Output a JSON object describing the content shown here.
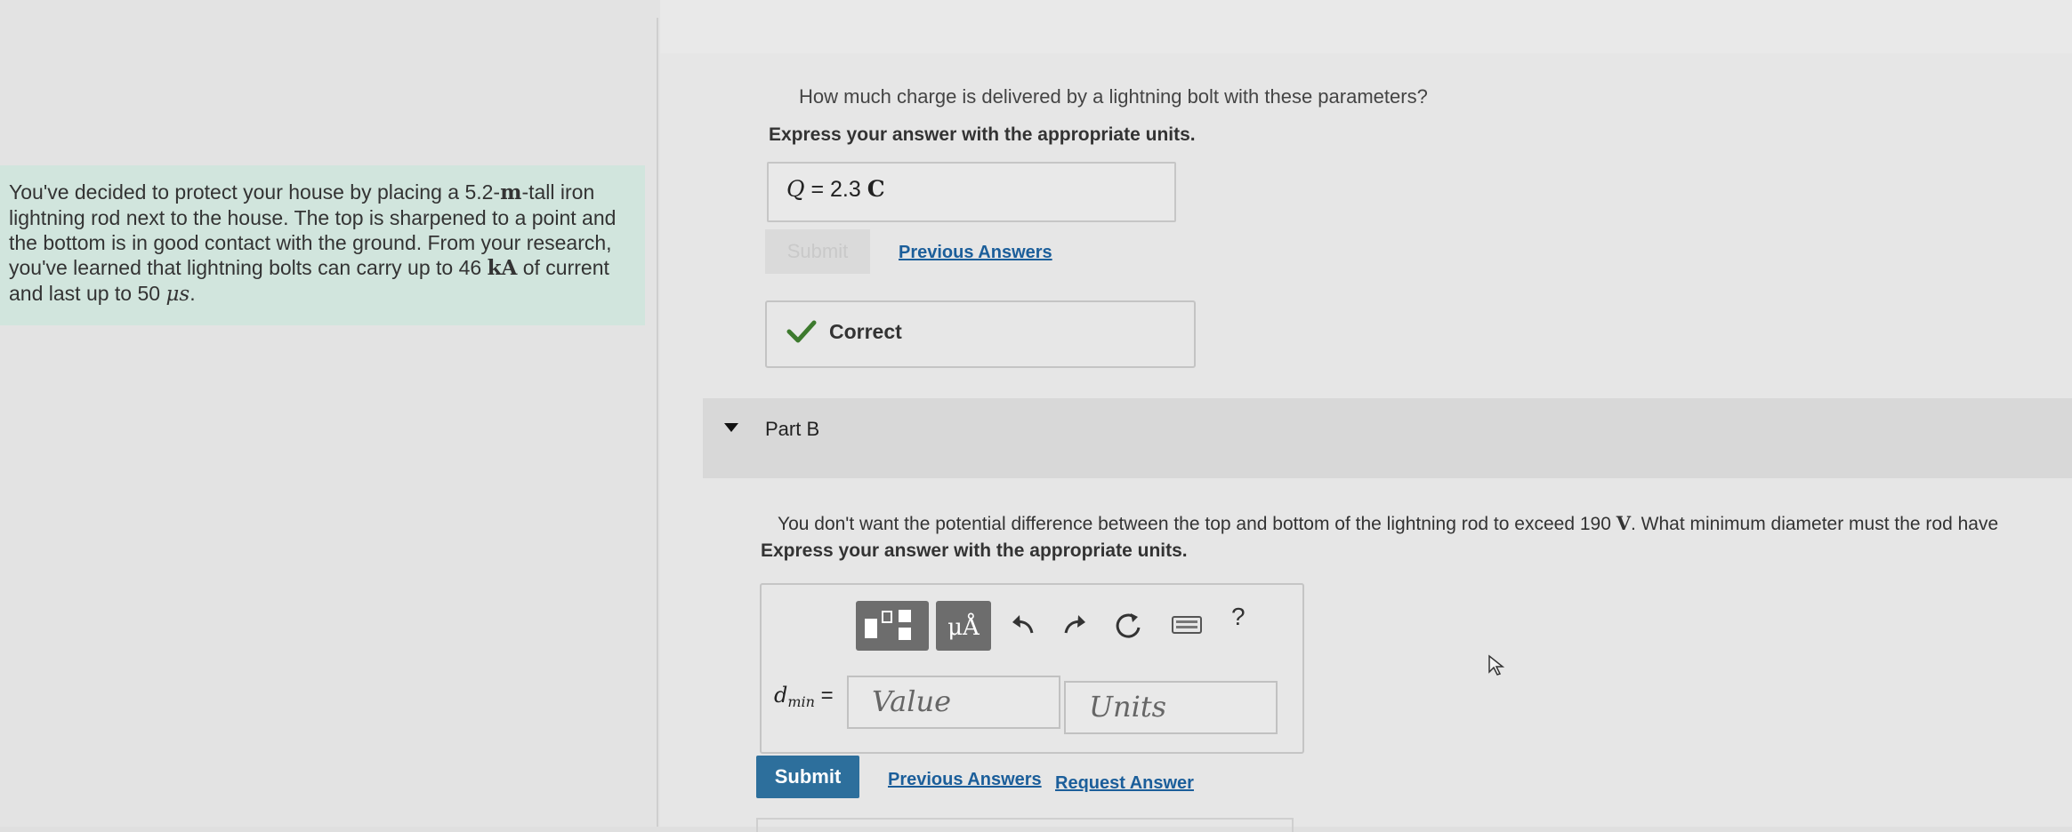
{
  "problem": {
    "t1": "You've decided to protect your house by placing a 5.2-",
    "u1": "m",
    "t2": "-tall iron lightning rod next to the house. The top is sharpened to a point and the bottom is in good contact with the ground. From your research, you've learned that lightning bolts can carry up to 46 ",
    "u2": "kA",
    "t3": " of current and last up to 50 ",
    "u3": "μs",
    "t4": "."
  },
  "part_a": {
    "question": "How much charge is delivered by a lightning bolt with these parameters?",
    "instruction": "Express your answer with the appropriate units.",
    "answer_var": "Q",
    "answer_eq": " = ",
    "answer_value": "2.3 ",
    "answer_unit": "C",
    "submit_label": "Submit",
    "previous_answers_label": "Previous Answers",
    "result_label": "Correct"
  },
  "part_b": {
    "label": "Part B",
    "q1": "You don't want the potential difference between the top and bottom of the lightning rod to exceed 190 ",
    "qu": "V",
    "q2": ". What minimum diameter must the rod have",
    "instruction": "Express your answer with the appropriate units.",
    "units_button": "μÅ",
    "help": "?",
    "var_main": "d",
    "var_sub": "min",
    "var_eq": " =",
    "value_placeholder": "Value",
    "units_placeholder": "Units",
    "submit_label": "Submit",
    "previous_answers_label": "Previous Answers",
    "request_answer_label": "Request Answer"
  },
  "colors": {
    "problem_bg": "#d1e5dd",
    "submit_active": "#2d6f9c",
    "link": "#1b5e9a",
    "correct_check": "#3d7a2e"
  }
}
